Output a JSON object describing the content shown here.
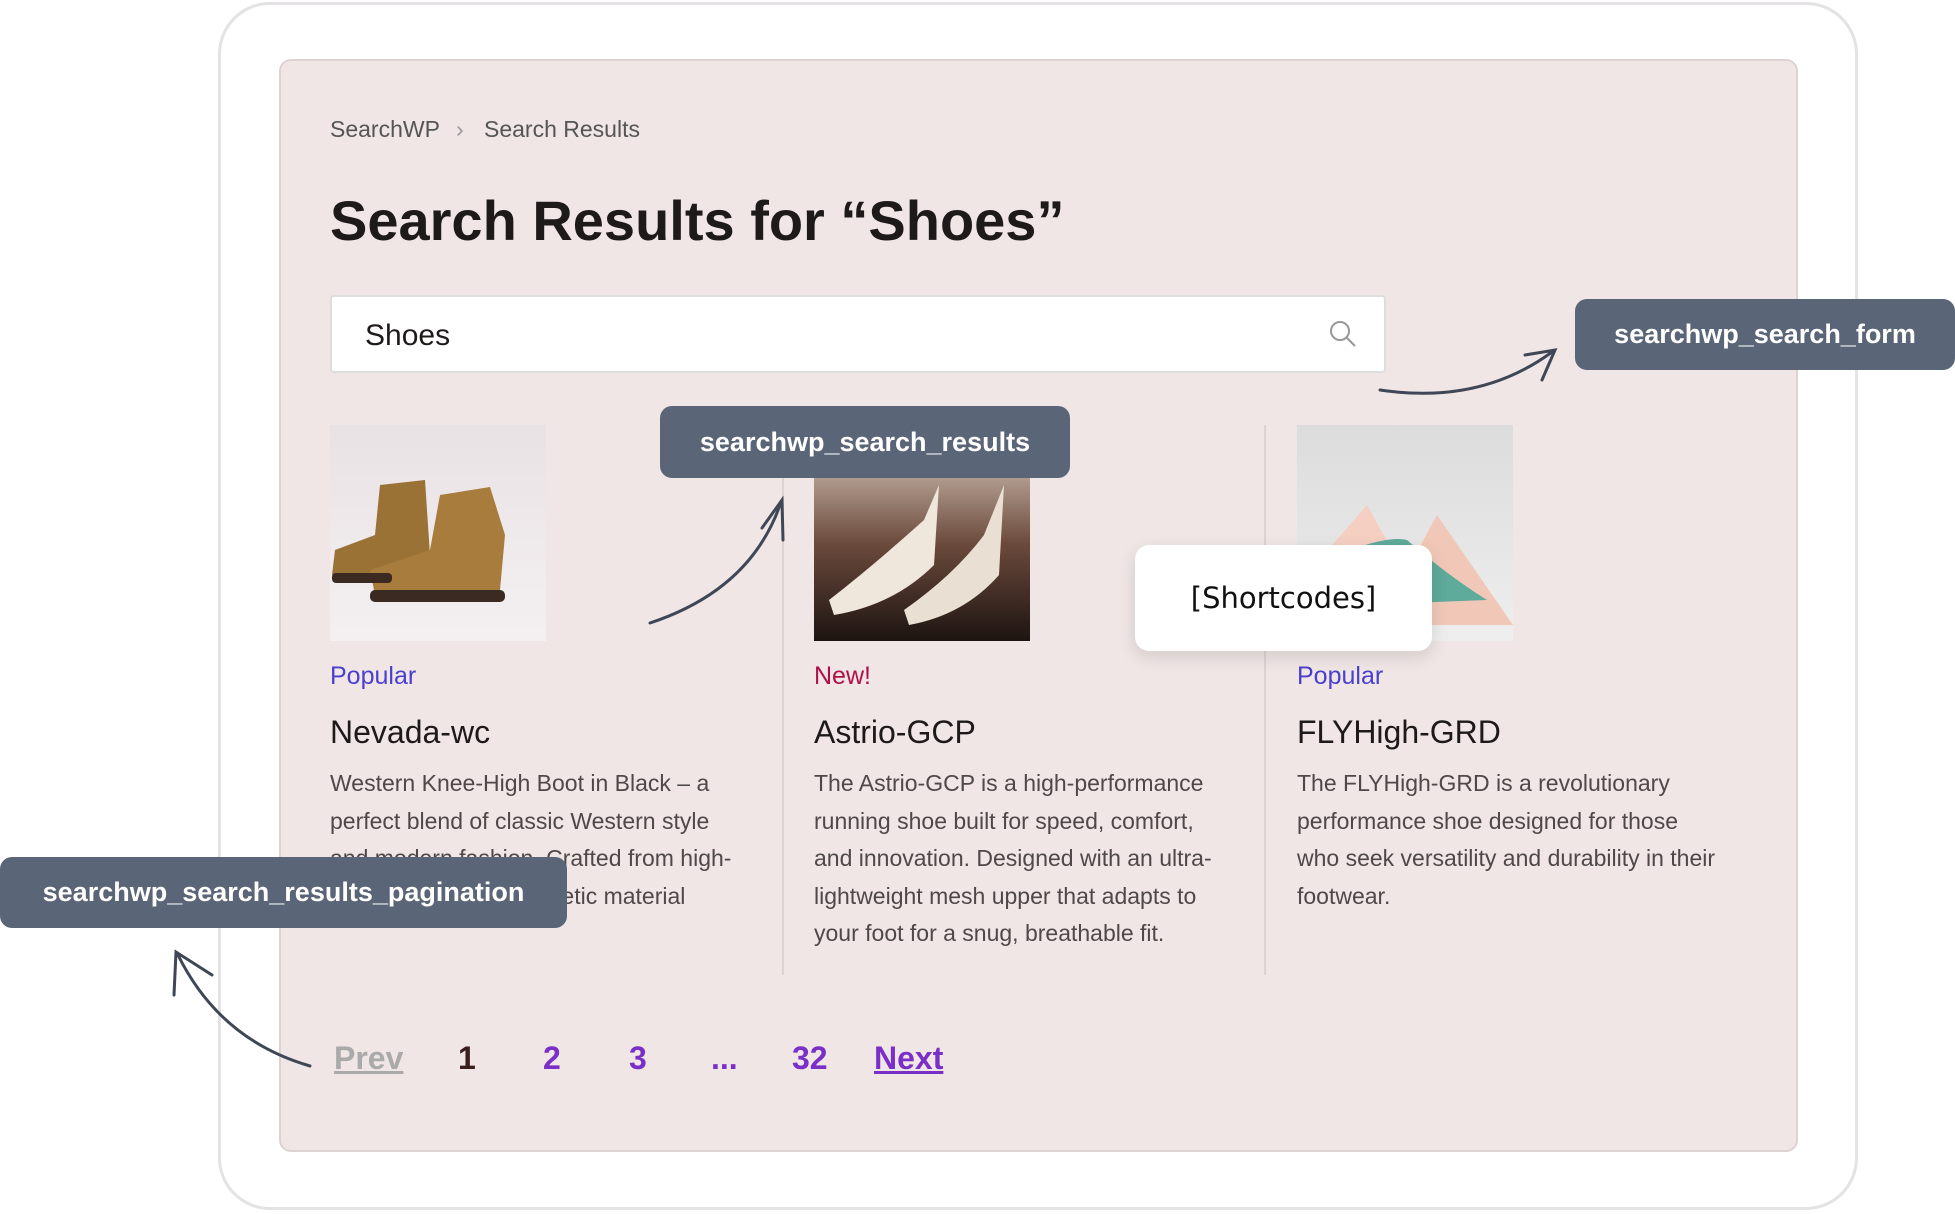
{
  "breadcrumb": {
    "root": "SearchWP",
    "current": "Search Results"
  },
  "title": "Search Results for “Shoes”",
  "search": {
    "value": "Shoes",
    "icon": "search-icon"
  },
  "results": [
    {
      "tag": "Popular",
      "tag_color": "#4a3fce",
      "name": "Nevada-wc",
      "description": "Western Knee-High Boot in Black – a perfect blend of classic Western style and modern fashion. Crafted from high-quality leather or synthetic material"
    },
    {
      "tag": "New!",
      "tag_color": "#b0104a",
      "name": "Astrio-GCP",
      "description": "The Astrio-GCP is a high-performance running shoe built for speed, comfort, and innovation. Designed with an ultra-lightweight mesh upper that adapts to your foot for a snug, breathable fit."
    },
    {
      "tag": "Popular",
      "tag_color": "#4a3fce",
      "name": "FLYHigh-GRD",
      "description": "The FLYHigh-GRD is a revolutionary performance shoe designed for those who seek versatility and durability in their footwear."
    }
  ],
  "pagination": {
    "prev": "Prev",
    "pages": [
      "1",
      "2",
      "3",
      "...",
      "32"
    ],
    "current": "1",
    "next": "Next"
  },
  "annotations": {
    "search_form": "searchwp_search_form",
    "search_results": "searchwp_search_results",
    "pagination": "searchwp_search_results_pagination",
    "shortcodes": "[Shortcodes]"
  },
  "colors": {
    "panel": "#efe6e5",
    "label": "#5a6577",
    "page_link": "#7b2fc9"
  }
}
